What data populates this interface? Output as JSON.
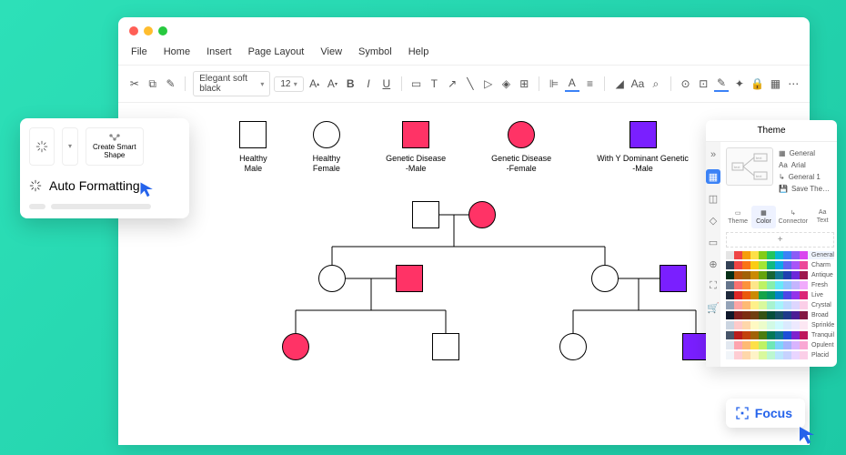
{
  "menu": {
    "file": "File",
    "home": "Home",
    "insert": "Insert",
    "page_layout": "Page Layout",
    "view": "View",
    "symbol": "Symbol",
    "help": "Help"
  },
  "toolbar": {
    "font_name": "Elegant soft black",
    "font_size": "12",
    "scissors": "✂",
    "clipboard": "📋",
    "brush": "✎",
    "A_inc": "A",
    "A_dec": "A",
    "bold": "B",
    "italic": "I",
    "underline": "U"
  },
  "legend": {
    "healthy_male": "Healthy\nMale",
    "healthy_female": "Healthy\nFemale",
    "genetic_male": "Genetic Disease\n-Male",
    "genetic_female": "Genetic Disease\n-Female",
    "y_dominant_male": "With Y Dominant Genetic\n-Male"
  },
  "popup": {
    "create_smart_shape": "Create Smart\nShape",
    "auto_formatting": "Auto Formatting"
  },
  "theme_panel": {
    "title": "Theme",
    "general": "General",
    "arial": "Arial",
    "general1": "General 1",
    "save_theme": "Save The…",
    "tab_theme": "Theme",
    "tab_color": "Color",
    "tab_connector": "Connector",
    "tab_text": "Text",
    "plus": "+",
    "swatch_names": [
      "General",
      "Charm",
      "Antique",
      "Fresh",
      "Live",
      "Crystal",
      "Broad",
      "Sprinkle",
      "Tranquil",
      "Opulent",
      "Placid"
    ]
  },
  "focus": {
    "label": "Focus"
  },
  "colors": {
    "red": "#ff3366",
    "purple": "#7a1fff",
    "blue": "#2563eb"
  },
  "swatch_rows": [
    [
      "#e5e5e5",
      "#ef4444",
      "#f59e0b",
      "#fde047",
      "#84cc16",
      "#22c55e",
      "#06b6d4",
      "#3b82f6",
      "#8b5cf6",
      "#d946ef"
    ],
    [
      "#334155",
      "#ef4444",
      "#f97316",
      "#facc15",
      "#a3e635",
      "#10b981",
      "#0ea5e9",
      "#6366f1",
      "#a855f7",
      "#ec4899"
    ],
    [
      "#052e16",
      "#b45309",
      "#a16207",
      "#ca8a04",
      "#65a30d",
      "#166534",
      "#0e7490",
      "#1e40af",
      "#6d28d9",
      "#9d174d"
    ],
    [
      "#64748b",
      "#f87171",
      "#fb923c",
      "#fde68a",
      "#bef264",
      "#86efac",
      "#67e8f9",
      "#93c5fd",
      "#c4b5fd",
      "#f0abfc"
    ],
    [
      "#1e293b",
      "#dc2626",
      "#ea580c",
      "#ca8a04",
      "#16a34a",
      "#059669",
      "#0284c7",
      "#4f46e5",
      "#9333ea",
      "#db2777"
    ],
    [
      "#94a3b8",
      "#fca5a5",
      "#fdba74",
      "#fef08a",
      "#d9f99d",
      "#a7f3d0",
      "#a5f3fc",
      "#bfdbfe",
      "#ddd6fe",
      "#fbcfe8"
    ],
    [
      "#0f172a",
      "#7f1d1d",
      "#7c2d12",
      "#713f12",
      "#365314",
      "#064e3b",
      "#164e63",
      "#1e3a8a",
      "#4c1d95",
      "#831843"
    ],
    [
      "#cbd5e1",
      "#fecaca",
      "#fed7aa",
      "#fef9c3",
      "#ecfccb",
      "#d1fae5",
      "#cffafe",
      "#dbeafe",
      "#ede9fe",
      "#fce7f3"
    ],
    [
      "#475569",
      "#b91c1c",
      "#c2410c",
      "#a16207",
      "#4d7c0f",
      "#047857",
      "#0e7490",
      "#1d4ed8",
      "#7e22ce",
      "#be185d"
    ],
    [
      "#e2e8f0",
      "#fda4af",
      "#fdba74",
      "#fde047",
      "#bef264",
      "#6ee7b7",
      "#7dd3fc",
      "#a5b4fc",
      "#d8b4fe",
      "#f9a8d4"
    ],
    [
      "#f1f5f9",
      "#fecdd3",
      "#fed7aa",
      "#fef3c7",
      "#d9f99d",
      "#bbf7d0",
      "#bae6fd",
      "#c7d2fe",
      "#e9d5ff",
      "#fbcfe8"
    ]
  ]
}
